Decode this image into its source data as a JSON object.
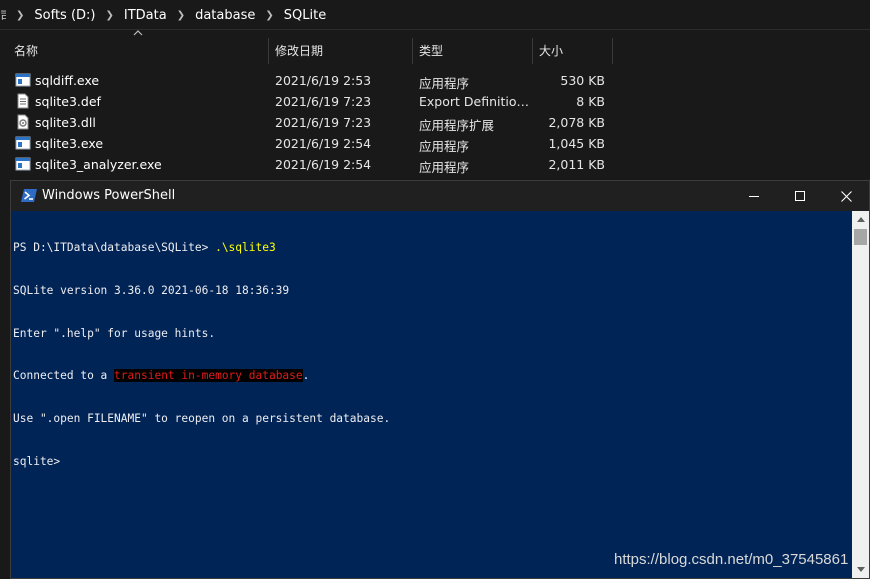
{
  "explorer": {
    "breadcrumb": [
      {
        "label": "Softs (D:)"
      },
      {
        "label": "ITData"
      },
      {
        "label": "database"
      },
      {
        "label": "SQLite"
      }
    ],
    "edge_glyph": "司",
    "columns": {
      "name": "名称",
      "date": "修改日期",
      "type": "类型",
      "size": "大小"
    },
    "files": [
      {
        "name": "sqldiff.exe",
        "date": "2021/6/19 2:53",
        "type": "应用程序",
        "size": "530 KB",
        "icon": "exe-icon"
      },
      {
        "name": "sqlite3.def",
        "date": "2021/6/19 7:23",
        "type": "Export Definition...",
        "size": "8 KB",
        "icon": "document-icon"
      },
      {
        "name": "sqlite3.dll",
        "date": "2021/6/19 7:23",
        "type": "应用程序扩展",
        "size": "2,078 KB",
        "icon": "dll-icon"
      },
      {
        "name": "sqlite3.exe",
        "date": "2021/6/19 2:54",
        "type": "应用程序",
        "size": "1,045 KB",
        "icon": "exe-icon"
      },
      {
        "name": "sqlite3_analyzer.exe",
        "date": "2021/6/19 2:54",
        "type": "应用程序",
        "size": "2,011 KB",
        "icon": "exe-icon"
      }
    ]
  },
  "powershell": {
    "title": "Windows PowerShell",
    "colors": {
      "background": "#012456",
      "command": "#ffff00",
      "highlight_fg": "#e01b1b",
      "highlight_bg": "#000000"
    },
    "lines": {
      "prompt": "PS D:\\ITData\\database\\SQLite> ",
      "command": ".\\sqlite3",
      "version": "SQLite version 3.36.0 2021-06-18 18:36:39",
      "help_hint": "Enter \".help\" for usage hints.",
      "connected_prefix": "Connected to a ",
      "connected_highlight": "transient in-memory database",
      "connected_suffix": ".",
      "open_hint": "Use \".open FILENAME\" to reopen on a persistent database.",
      "sqlite_prompt": "sqlite> "
    }
  },
  "watermark": "https://blog.csdn.net/m0_37545861"
}
